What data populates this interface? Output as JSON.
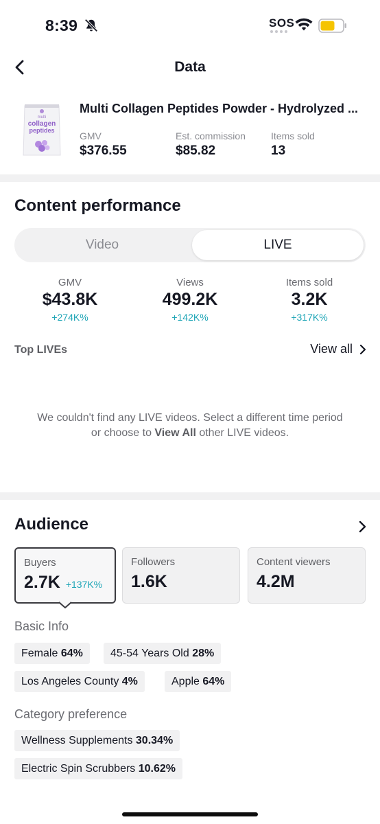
{
  "status_bar": {
    "time": "8:39",
    "sos": "SOS",
    "battery_color": "#f5c400"
  },
  "nav": {
    "title": "Data"
  },
  "product": {
    "name": "Multi Collagen Peptides Powder - Hydrolyzed ...",
    "thumb_text": [
      "multi",
      "collagen",
      "peptides"
    ],
    "stats": [
      {
        "label": "GMV",
        "value": "$376.55"
      },
      {
        "label": "Est. commission",
        "value": "$85.82"
      },
      {
        "label": "Items sold",
        "value": "13"
      }
    ]
  },
  "content_performance": {
    "title": "Content performance",
    "tabs": [
      {
        "label": "Video",
        "selected": false
      },
      {
        "label": "LIVE",
        "selected": true
      }
    ],
    "metrics": [
      {
        "label": "GMV",
        "value": "$43.8K",
        "change": "+274K%"
      },
      {
        "label": "Views",
        "value": "499.2K",
        "change": "+142K%"
      },
      {
        "label": "Items sold",
        "value": "3.2K",
        "change": "+317K%"
      }
    ],
    "top_lives_label": "Top LIVEs",
    "view_all_label": "View all",
    "empty_line1": "We couldn't find any LIVE videos. Select a different time period",
    "empty_line2_pre": "or choose to ",
    "empty_line2_bold": "View All",
    "empty_line2_post": " other LIVE videos.",
    "accent_color": "#20a6b7"
  },
  "audience": {
    "title": "Audience",
    "cards": [
      {
        "label": "Buyers",
        "value": "2.7K",
        "change": "+137K%",
        "selected": true
      },
      {
        "label": "Followers",
        "value": "1.6K",
        "change": "",
        "selected": false
      },
      {
        "label": "Content viewers",
        "value": "4.2M",
        "change": "",
        "selected": false
      }
    ],
    "basic_info_title": "Basic Info",
    "basic_info": [
      {
        "label": "Female",
        "value": "64%"
      },
      {
        "label": "45-54 Years Old",
        "value": "28%"
      },
      {
        "label": "Los Angeles County",
        "value": "4%"
      },
      {
        "label": "Apple",
        "value": "64%"
      }
    ],
    "category_title": "Category preference",
    "categories": [
      {
        "label": "Wellness Supplements",
        "value": "30.34%"
      },
      {
        "label": "Electric Spin Scrubbers",
        "value": "10.62%"
      }
    ]
  }
}
